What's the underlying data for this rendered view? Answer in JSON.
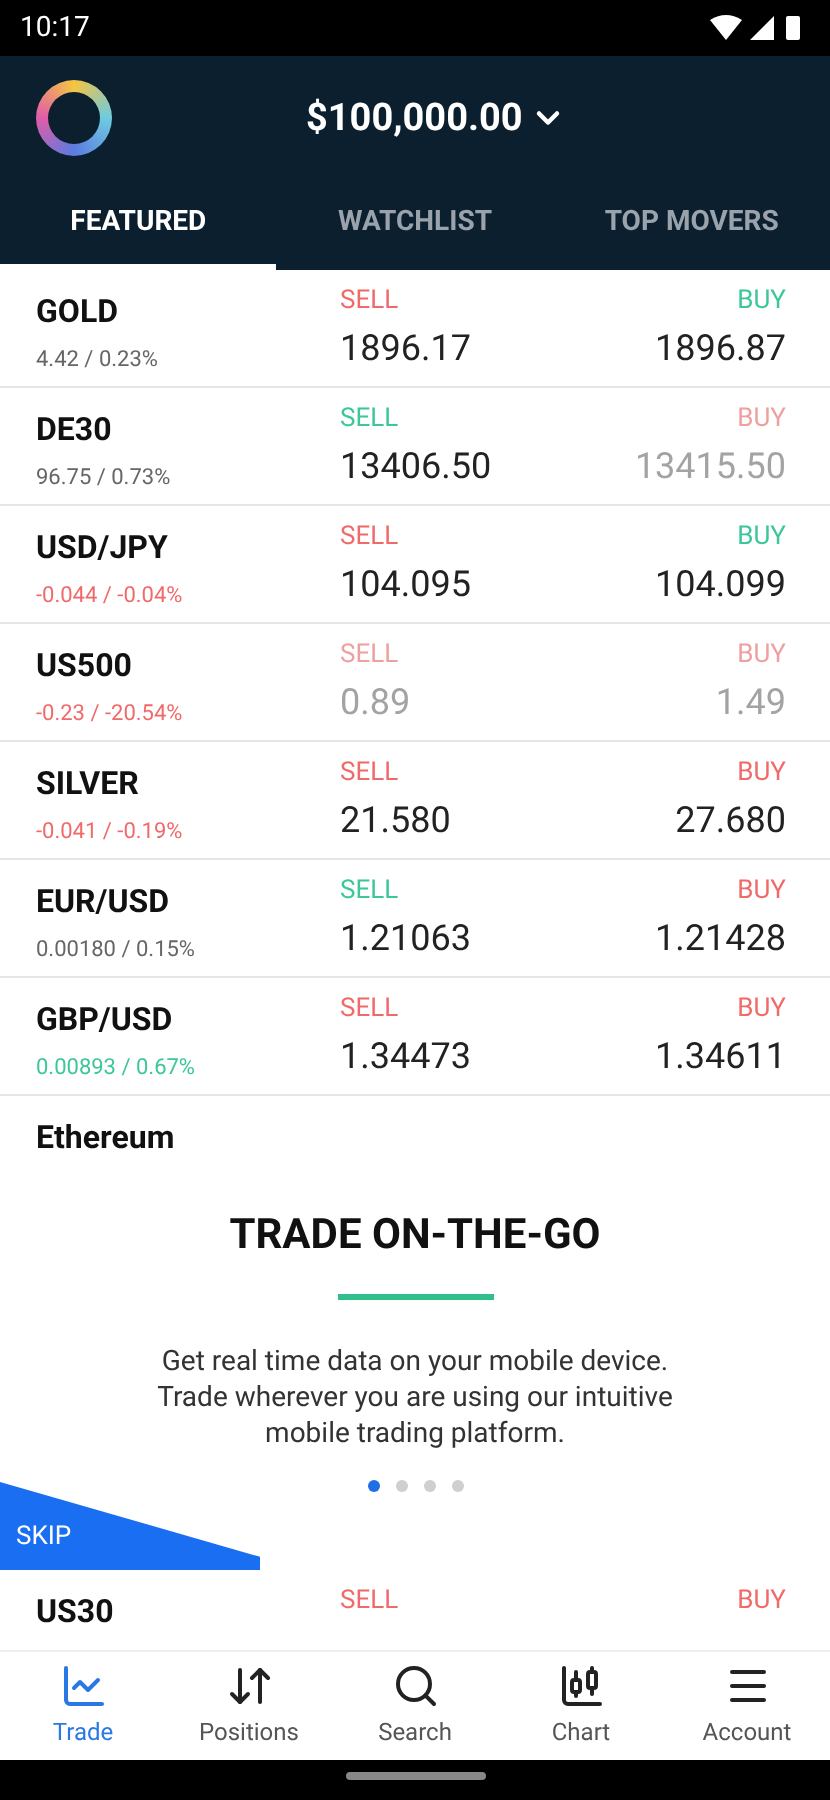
{
  "status_bar": {
    "time": "10:17"
  },
  "header": {
    "balance": "$100,000.00"
  },
  "tabs": [
    {
      "label": "FEATURED",
      "selected": true
    },
    {
      "label": "WATCHLIST",
      "selected": false
    },
    {
      "label": "TOP MOVERS",
      "selected": false
    }
  ],
  "rows": [
    {
      "name": "GOLD",
      "change": "4.42 / 0.23%",
      "color": "#666666",
      "sell": {
        "label": "SELL",
        "color": "#f06a6a",
        "price": "1896.17",
        "stale": false
      },
      "buy": {
        "label": "BUY",
        "color": "#3cc79a",
        "price": "1896.87",
        "stale": false
      }
    },
    {
      "name": "DE30",
      "change": "96.75 / 0.73%",
      "color": "#666666",
      "sell": {
        "label": "SELL",
        "color": "#3cc79a",
        "price": "13406.50",
        "stale": false
      },
      "buy": {
        "label": "BUY",
        "color": "#eea0a0",
        "price": "13415.50",
        "stale": true
      }
    },
    {
      "name": "USD/JPY",
      "change": "-0.044 / -0.04%",
      "color": "#f06a6a",
      "sell": {
        "label": "SELL",
        "color": "#f06a6a",
        "price": "104.095",
        "stale": false
      },
      "buy": {
        "label": "BUY",
        "color": "#3cc79a",
        "price": "104.099",
        "stale": false
      }
    },
    {
      "name": "US500",
      "change": "-0.23 / -20.54%",
      "color": "#f06a6a",
      "sell": {
        "label": "SELL",
        "color": "#eea0a0",
        "price": "0.89",
        "stale": true
      },
      "buy": {
        "label": "BUY",
        "color": "#eea0a0",
        "price": "1.49",
        "stale": true
      }
    },
    {
      "name": "SILVER",
      "change": "-0.041 / -0.19%",
      "color": "#f06a6a",
      "sell": {
        "label": "SELL",
        "color": "#f06a6a",
        "price": "21.580",
        "stale": false
      },
      "buy": {
        "label": "BUY",
        "color": "#f06a6a",
        "price": "27.680",
        "stale": false
      }
    },
    {
      "name": "EUR/USD",
      "change": "0.00180 / 0.15%",
      "color": "#666666",
      "sell": {
        "label": "SELL",
        "color": "#3cc79a",
        "price": "1.21063",
        "stale": false
      },
      "buy": {
        "label": "BUY",
        "color": "#f06a6a",
        "price": "1.21428",
        "stale": false
      }
    },
    {
      "name": "GBP/USD",
      "change": "0.00893 / 0.67%",
      "color": "#3cc79a",
      "sell": {
        "label": "SELL",
        "color": "#f06a6a",
        "price": "1.34473",
        "stale": false
      },
      "buy": {
        "label": "BUY",
        "color": "#f06a6a",
        "price": "1.34611",
        "stale": false
      }
    },
    {
      "name": "Ethereum"
    }
  ],
  "last_row": {
    "name": "US30",
    "sell": {
      "label": "SELL",
      "color": "#f06a6a"
    },
    "buy": {
      "label": "BUY",
      "color": "#f06a6a"
    }
  },
  "onboarding": {
    "title": "TRADE ON-THE-GO",
    "text": "Get real time data on your mobile device. Trade wherever you are using our intuitive mobile trading platform.",
    "dots": [
      {
        "selected": true
      },
      {
        "selected": false
      },
      {
        "selected": false
      },
      {
        "selected": false
      }
    ],
    "skip": "SKIP"
  },
  "nav": [
    {
      "kind": "trade",
      "label": "Trade",
      "selected": true
    },
    {
      "kind": "positions",
      "label": "Positions",
      "selected": false
    },
    {
      "kind": "search",
      "label": "Search",
      "selected": false
    },
    {
      "kind": "chart",
      "label": "Chart",
      "selected": false
    },
    {
      "kind": "account",
      "label": "Account",
      "selected": false
    }
  ]
}
